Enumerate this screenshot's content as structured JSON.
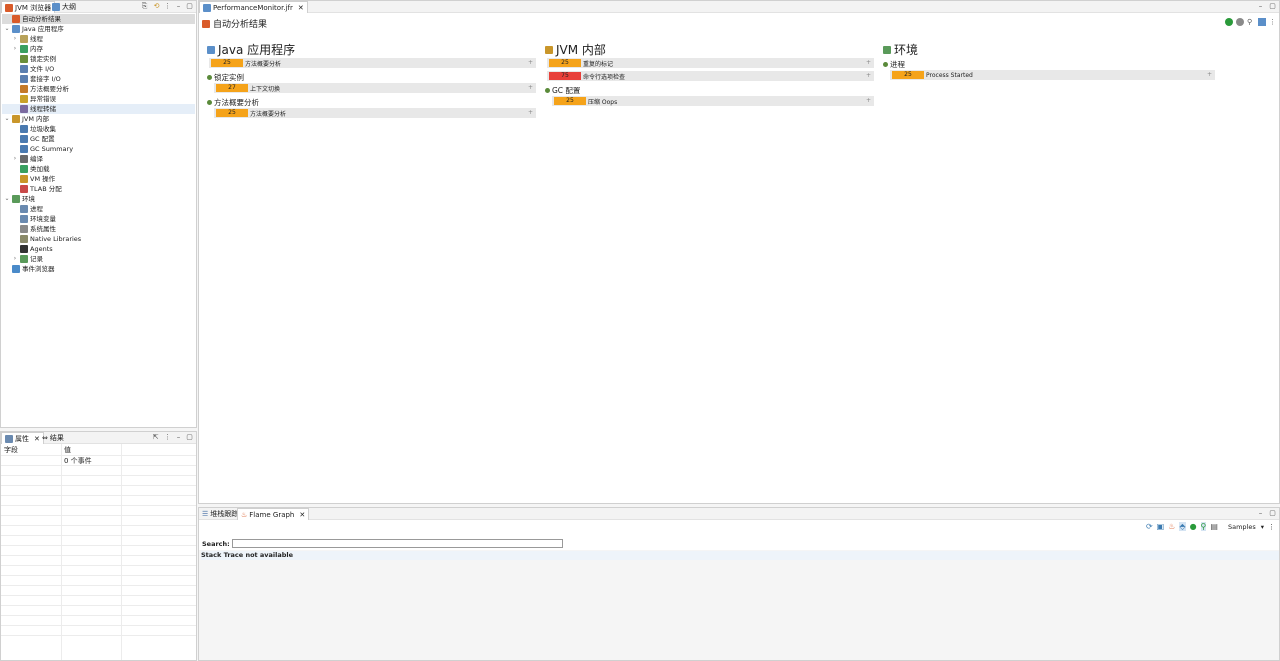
{
  "left_top_view": {
    "tabs": [
      {
        "label": "JVM 浏览器"
      },
      {
        "label": "大纲"
      }
    ],
    "tree": [
      {
        "label": "自动分析结果",
        "indent": 0,
        "chev": "",
        "icon": "#d95b2a",
        "icon_name": "analysis-icon"
      },
      {
        "label": "Java 应用程序",
        "indent": 0,
        "chev": "⌄",
        "icon": "#5b8fc9",
        "icon_name": "java-app-icon"
      },
      {
        "label": "线程",
        "indent": 1,
        "chev": "›",
        "icon": "#b8a25a",
        "icon_name": "thread-icon"
      },
      {
        "label": "内存",
        "indent": 1,
        "chev": "›",
        "icon": "#3aa060",
        "icon_name": "memory-icon"
      },
      {
        "label": "锁定实例",
        "indent": 1,
        "chev": "",
        "icon": "#6a8f3a",
        "icon_name": "lock-icon"
      },
      {
        "label": "文件 I/O",
        "indent": 1,
        "chev": "",
        "icon": "#5b7fb0",
        "icon_name": "file-io-icon"
      },
      {
        "label": "套接字 I/O",
        "indent": 1,
        "chev": "",
        "icon": "#5b7fb0",
        "icon_name": "socket-io-icon"
      },
      {
        "label": "方法概要分析",
        "indent": 1,
        "chev": "",
        "icon": "#c47a2a",
        "icon_name": "method-profiling-icon"
      },
      {
        "label": "异常错误",
        "indent": 1,
        "chev": "",
        "icon": "#c9a22a",
        "icon_name": "exception-icon"
      },
      {
        "label": "线程转储",
        "indent": 1,
        "chev": "",
        "icon": "#7a6aa0",
        "icon_name": "thread-dump-icon"
      },
      {
        "label": "JVM 内部",
        "indent": 0,
        "chev": "⌄",
        "icon": "#c9962a",
        "icon_name": "jvm-internals-icon"
      },
      {
        "label": "垃圾收集",
        "indent": 1,
        "chev": "",
        "icon": "#4a7ab0",
        "icon_name": "gc-icon"
      },
      {
        "label": "GC 配置",
        "indent": 1,
        "chev": "",
        "icon": "#4a7ab0",
        "icon_name": "gc-config-icon"
      },
      {
        "label": "GC Summary",
        "indent": 1,
        "chev": "",
        "icon": "#4a7ab0",
        "icon_name": "gc-summary-icon"
      },
      {
        "label": "编译",
        "indent": 1,
        "chev": "›",
        "icon": "#6a6a6a",
        "icon_name": "compilation-icon"
      },
      {
        "label": "类加载",
        "indent": 1,
        "chev": "",
        "icon": "#3aa060",
        "icon_name": "class-loading-icon"
      },
      {
        "label": "VM 操作",
        "indent": 1,
        "chev": "",
        "icon": "#c9962a",
        "icon_name": "vm-operations-icon"
      },
      {
        "label": "TLAB 分配",
        "indent": 1,
        "chev": "",
        "icon": "#c94a4a",
        "icon_name": "tlab-icon"
      },
      {
        "label": "环境",
        "indent": 0,
        "chev": "⌄",
        "icon": "#5a9a5a",
        "icon_name": "environment-icon"
      },
      {
        "label": "进程",
        "indent": 1,
        "chev": "",
        "icon": "#6a8ab0",
        "icon_name": "process-icon"
      },
      {
        "label": "环境变量",
        "indent": 1,
        "chev": "",
        "icon": "#6a8ab0",
        "icon_name": "env-vars-icon"
      },
      {
        "label": "系统属性",
        "indent": 1,
        "chev": "",
        "icon": "#8a8a8a",
        "icon_name": "system-props-icon"
      },
      {
        "label": "Native Libraries",
        "indent": 1,
        "chev": "",
        "icon": "#8a8a6a",
        "icon_name": "native-libs-icon"
      },
      {
        "label": "Agents",
        "indent": 1,
        "chev": "",
        "icon": "#333333",
        "icon_name": "agents-icon"
      },
      {
        "label": "记录",
        "indent": 1,
        "chev": "›",
        "icon": "#5a9a5a",
        "icon_name": "recording-icon"
      },
      {
        "label": "事件浏览器",
        "indent": 0,
        "chev": "",
        "icon": "#4a8ac9",
        "icon_name": "event-browser-icon"
      }
    ]
  },
  "left_bottom_view": {
    "tabs": [
      {
        "label": "属性"
      },
      {
        "label": "结果"
      }
    ],
    "headers": {
      "field": "字段",
      "value": "值"
    },
    "row0_value": "0 个事件"
  },
  "editor": {
    "tab_label": "PerformanceMonitor.jfr",
    "page_title": "自动分析结果",
    "columns": [
      {
        "title": "Java 应用程序",
        "icon": "#5b8fc9",
        "items": [
          {
            "kind": "row",
            "score": 25,
            "label": "方法概要分析"
          },
          {
            "kind": "sub",
            "label": "锁定实例"
          },
          {
            "kind": "row",
            "score": 27,
            "label": "上下文切换"
          },
          {
            "kind": "sub",
            "label": "方法概要分析"
          },
          {
            "kind": "row",
            "score": 25,
            "label": "方法概要分析"
          }
        ]
      },
      {
        "title": "JVM 内部",
        "icon": "#c9962a",
        "items": [
          {
            "kind": "row",
            "score": 25,
            "label": "重复的标记"
          },
          {
            "kind": "row",
            "score": 75,
            "label": "命令行选项检查",
            "severe": true
          },
          {
            "kind": "sub",
            "label": "GC 配置"
          },
          {
            "kind": "row",
            "score": 25,
            "label": "压缩 Oops"
          }
        ]
      },
      {
        "title": "环境",
        "icon": "#5a9a5a",
        "items": [
          {
            "kind": "sub",
            "label": "进程"
          },
          {
            "kind": "row",
            "score": 25,
            "label": "Process Started"
          }
        ]
      }
    ]
  },
  "bottom_view": {
    "tabs": [
      {
        "label": "堆栈跟踪"
      },
      {
        "label": "Flame Graph"
      }
    ],
    "search_label": "Search:",
    "search_value": "",
    "samples_label": "Samples",
    "message": "Stack Trace not available"
  },
  "colors": {
    "score_ok": "#f5a31a",
    "score_severe": "#e8403a"
  }
}
